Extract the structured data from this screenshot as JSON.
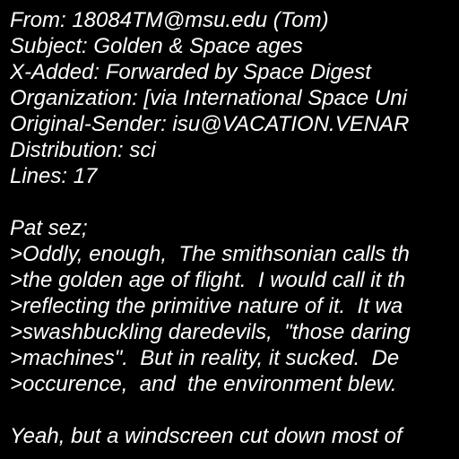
{
  "colors": {
    "background": "#000000",
    "text": "#ffffff"
  },
  "headers": {
    "from": "From: 18084TM@msu.edu (Tom)",
    "subject": "Subject: Golden & Space ages",
    "x_added": "X-Added: Forwarded by Space Digest",
    "organization": "Organization: [via International Space Uni",
    "original_sender": "Original-Sender: isu@VACATION.VENAR",
    "distribution": "Distribution: sci",
    "lines": "Lines: 17"
  },
  "body": {
    "intro": "Pat sez;",
    "quoted": [
      ">Oddly, enough,  The smithsonian calls th",
      ">the golden age of flight.  I would call it th",
      ">reflecting the primitive nature of it.  It wa",
      ">swashbuckling daredevils,  \"those daring",
      ">machines\".  But in reality, it sucked.  De",
      ">occurence,  and  the environment blew."
    ],
    "reply": "Yeah, but a windscreen cut down most of"
  }
}
